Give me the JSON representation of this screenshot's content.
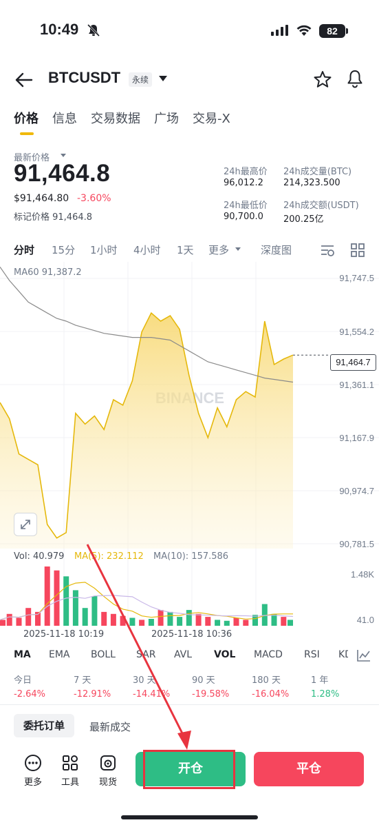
{
  "status_bar": {
    "time": "10:49",
    "battery": "82"
  },
  "header": {
    "symbol": "BTCUSDT",
    "badge": "永续"
  },
  "tabs": [
    {
      "label": "价格",
      "active": true
    },
    {
      "label": "信息"
    },
    {
      "label": "交易数据"
    },
    {
      "label": "广场"
    },
    {
      "label": "交易-X"
    }
  ],
  "price": {
    "label": "最新价格",
    "last": "91,464.8",
    "usd": "$91,464.80",
    "change": "-3.60%",
    "mark": "标记价格 91,464.8"
  },
  "stats": {
    "high_label": "24h最高价",
    "high": "96,012.2",
    "vol_btc_label": "24h成交量(BTC)",
    "vol_btc": "214,323.500",
    "low_label": "24h最低价",
    "low": "90,700.0",
    "vol_usdt_label": "24h成交额(USDT)",
    "vol_usdt": "200.25亿"
  },
  "intervals": [
    "分时",
    "15分",
    "1小时",
    "4小时",
    "1天",
    "更多",
    "深度图"
  ],
  "chart": {
    "ma60": "MA60 91,387.2",
    "y_ticks": [
      "91,747.5",
      "91,554.2",
      "91,361.1",
      "91,167.9",
      "90,974.7",
      "90,781.5"
    ],
    "current_tag": "91,464.7",
    "watermark": "BINANCE",
    "colors": {
      "line": "#e5b80b",
      "fill": "#fbe9a9",
      "ma": "#8a8a8a",
      "up": "#2ebd85",
      "down": "#f6465d"
    }
  },
  "chart_data": {
    "type": "line",
    "y_range": [
      90781.5,
      91747.5
    ],
    "price": [
      91290,
      91230,
      91100,
      91080,
      91060,
      90840,
      90790,
      90810,
      91250,
      91210,
      91240,
      91190,
      91300,
      91280,
      91370,
      91550,
      91620,
      91590,
      91610,
      91560,
      91390,
      91250,
      91160,
      91270,
      91200,
      91300,
      91330,
      91310,
      91590,
      91430,
      91450,
      91464.7
    ],
    "ma60": [
      91790,
      91740,
      91700,
      91660,
      91640,
      91620,
      91600,
      91590,
      91575,
      91565,
      91555,
      91545,
      91540,
      91535,
      91530,
      91530,
      91530,
      91525,
      91520,
      91500,
      91480,
      91460,
      91440,
      91430,
      91420,
      91410,
      91400,
      91390,
      91380,
      91375,
      91370,
      91365
    ]
  },
  "volume": {
    "legend_vol": "Vol: 40.979",
    "legend_ma5": "MA(5): 232.112",
    "legend_ma10": "MA(10): 157.586",
    "y_top": "1.48K",
    "y_bottom": "41.0",
    "date1": "2025-11-18 10:19",
    "date2": "2025-11-18 10:36"
  },
  "volume_data": {
    "values": [
      30,
      60,
      40,
      90,
      70,
      300,
      280,
      250,
      180,
      90,
      150,
      70,
      60,
      50,
      40,
      30,
      35,
      80,
      70,
      45,
      80,
      60,
      45,
      30,
      25,
      40,
      30,
      55,
      110,
      60,
      45,
      30
    ],
    "up": [
      0,
      0,
      0,
      0,
      0,
      0,
      0,
      1,
      1,
      1,
      1,
      0,
      0,
      0,
      1,
      0,
      1,
      0,
      1,
      1,
      1,
      0,
      0,
      1,
      1,
      0,
      0,
      1,
      1,
      1,
      0,
      1
    ]
  },
  "indicators": [
    "MA",
    "EMA",
    "BOLL",
    "SAR",
    "AVL",
    "VOL",
    "MACD",
    "RSI",
    "KD"
  ],
  "performance": [
    {
      "label": "今日",
      "value": "-2.64%"
    },
    {
      "label": "7 天",
      "value": "-12.91%"
    },
    {
      "label": "30 天",
      "value": "-14.41%"
    },
    {
      "label": "90 天",
      "value": "-19.58%"
    },
    {
      "label": "180 天",
      "value": "-16.04%"
    },
    {
      "label": "1 年",
      "value": "1.28%"
    }
  ],
  "orders": {
    "tab1": "委托订单",
    "tab2": "最新成交"
  },
  "bottom": {
    "more": "更多",
    "tools": "工具",
    "spot": "现货",
    "open": "开仓",
    "close": "平仓"
  }
}
